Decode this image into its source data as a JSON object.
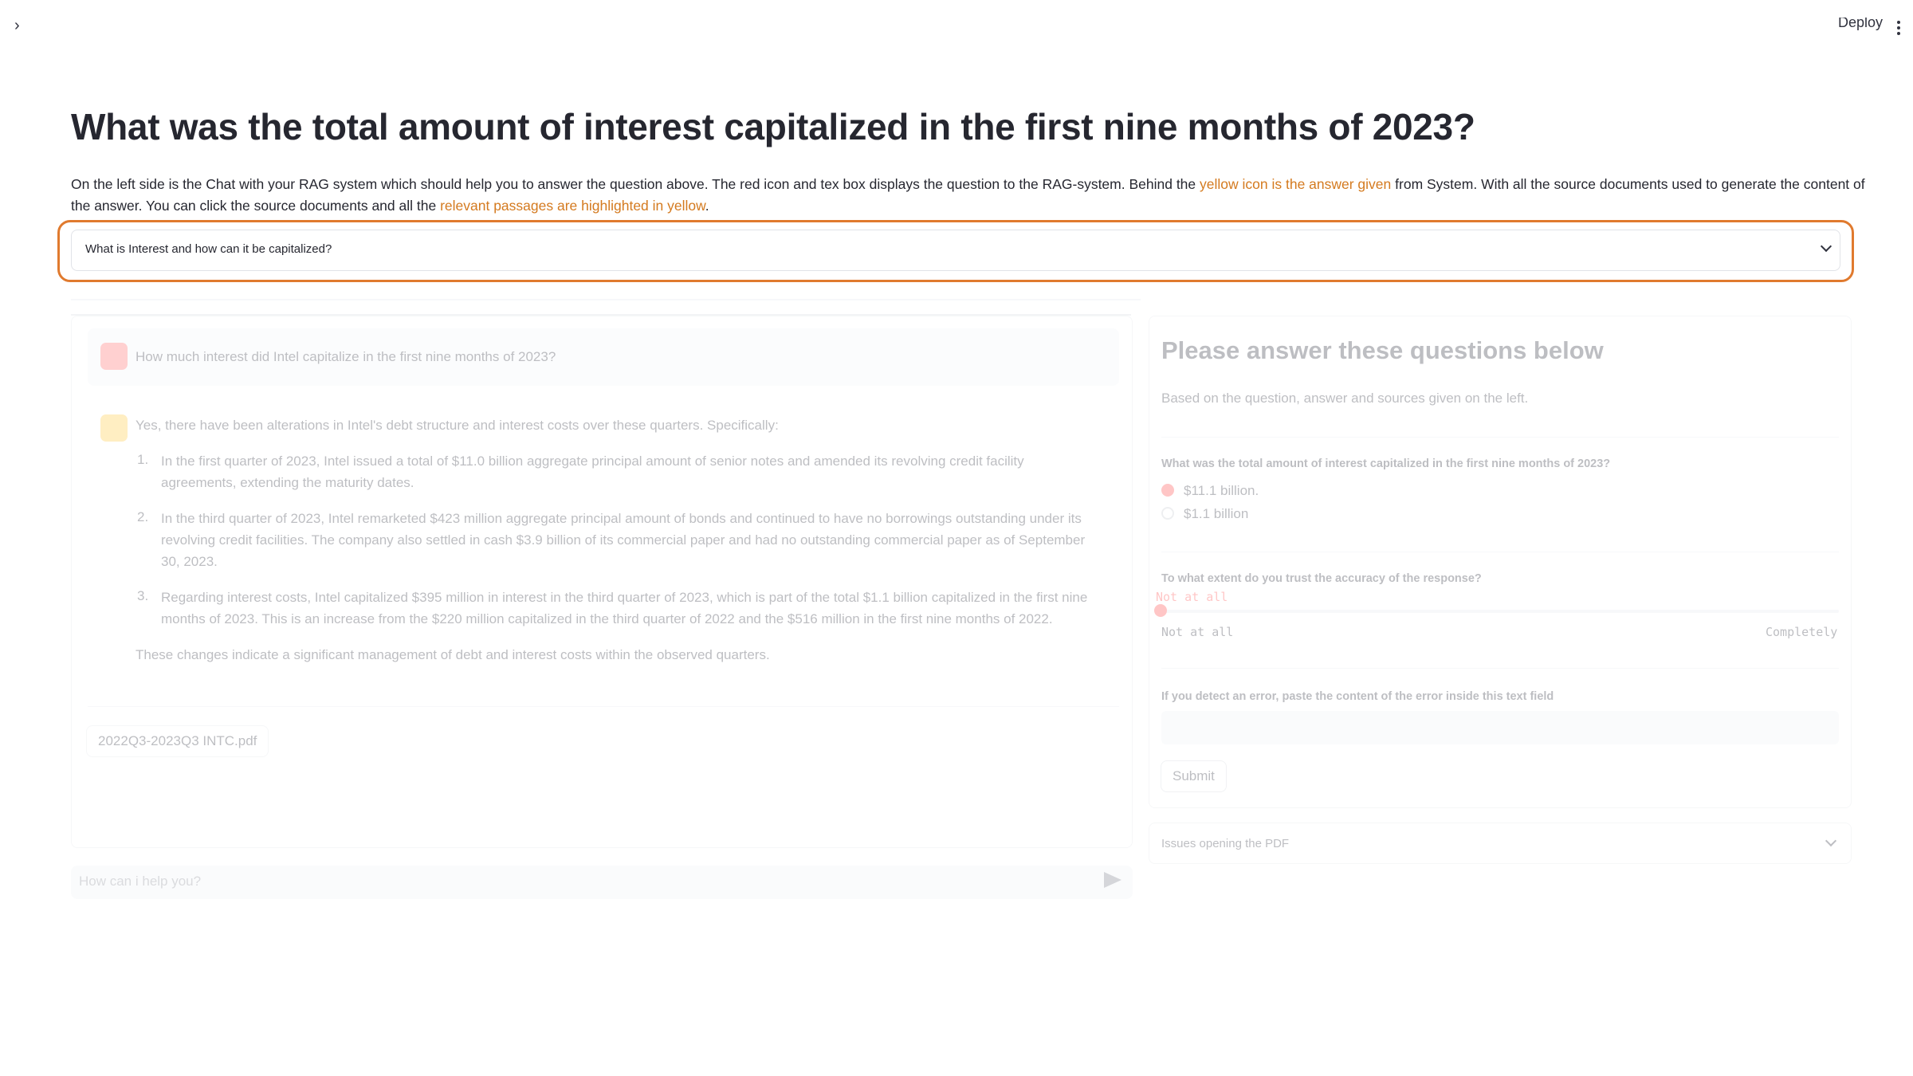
{
  "header": {
    "sidebar_toggle": "›",
    "deploy_label": "Deploy"
  },
  "page": {
    "title": "What was the total amount of interest capitalized in the first nine months of 2023?",
    "intro_part1": "On the left side is the Chat with your RAG system which should help you to answer the question above. The red icon and tex box displays the question to the RAG-system. Behind the ",
    "intro_hl1": "yellow icon is the answer given",
    "intro_part2": " from System. With all the source documents used to generate the content of the answer. You can click the source documents and all the ",
    "intro_hl2": "relevant passages are highlighted in yellow",
    "intro_part3": ".",
    "highlight_color": "#d47a1f",
    "outline_color": "#e07a2e"
  },
  "hint_expander": {
    "label": "What is Interest and how can it be capitalized?"
  },
  "chat": {
    "user_message": "How much interest did Intel capitalize in the first nine months of 2023?",
    "answer_intro": "Yes, there have been alterations in Intel's debt structure and interest costs over these quarters. Specifically:",
    "items": [
      {
        "num": "1.",
        "text": "In the first quarter of 2023, Intel issued a total of $11.0 billion aggregate principal amount of senior notes and amended its revolving credit facility agreements, extending the maturity dates."
      },
      {
        "num": "2.",
        "text": "In the third quarter of 2023, Intel remarketed $423 million aggregate principal amount of bonds and continued to have no borrowings outstanding under its revolving credit facilities. The company also settled in cash $3.9 billion of its commercial paper and had no outstanding commercial paper as of September 30, 2023."
      },
      {
        "num": "3.",
        "text": "Regarding interest costs, Intel capitalized $395 million in interest in the third quarter of 2023, which is part of the total $1.1 billion capitalized in the first nine months of 2023. This is an increase from the $220 million capitalized in the third quarter of 2022 and the $516 million in the first nine months of 2022."
      }
    ],
    "answer_outro": "These changes indicate a significant management of debt and interest costs within the observed quarters.",
    "source_document": "2022Q3-2023Q3 INTC.pdf",
    "input_placeholder": "How can i help you?",
    "user_icon_color": "#ff6b6b",
    "bot_icon_color": "#ffc940"
  },
  "form": {
    "title": "Please answer these questions below",
    "subtitle": "Based on the question, answer and sources given on the left.",
    "q1_label": "What was the total amount of interest capitalized in the first nine months of 2023?",
    "q1_options": [
      "$11.1 billion.",
      "$1.1 billion"
    ],
    "q1_selected": "$11.1 billion.",
    "q2_label": "To what extent do you trust the accuracy of the response?",
    "q2_value": "Not at all",
    "q2_min": "Not at all",
    "q2_max": "Completely",
    "q2_level": 0,
    "q3_label": "If you detect an error, paste the content of the error inside this text field",
    "q3_value": "",
    "submit_label": "Submit",
    "accent_color": "#ff4b4b"
  },
  "pdf_expander": {
    "label": "Issues opening the PDF"
  }
}
